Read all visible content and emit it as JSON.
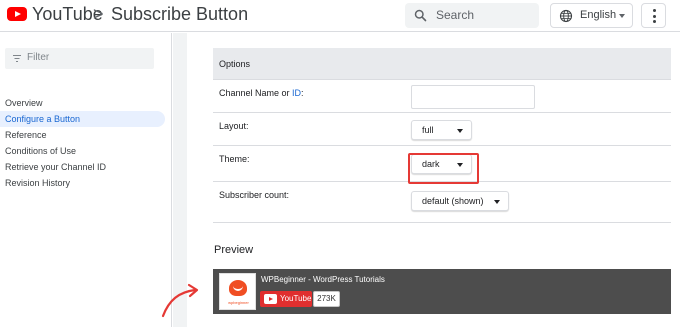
{
  "header": {
    "brand": "YouTube",
    "separator": ">",
    "crumb": "Subscribe Button",
    "search_placeholder": "Search",
    "language": "English"
  },
  "sidebar": {
    "filter_placeholder": "Filter",
    "items": [
      {
        "label": "Overview",
        "active": false
      },
      {
        "label": "Configure a Button",
        "active": true
      },
      {
        "label": "Reference",
        "active": false
      },
      {
        "label": "Conditions of Use",
        "active": false
      },
      {
        "label": "Retrieve your Channel ID",
        "active": false
      },
      {
        "label": "Revision History",
        "active": false
      }
    ]
  },
  "options": {
    "heading": "Options",
    "channel_label": "Channel Name or ",
    "channel_label_link": "ID",
    "channel_label_suffix": ":",
    "channel_value": "",
    "layout_label": "Layout:",
    "layout_value": "full",
    "theme_label": "Theme:",
    "theme_value": "dark",
    "subscriber_label": "Subscriber count:",
    "subscriber_value": "default (shown)"
  },
  "preview": {
    "title": "Preview",
    "channel_name": "WPBeginner - WordPress Tutorials",
    "avatar_text": "wpbeginner",
    "button_label": "YouTube",
    "subscriber_count": "273K"
  },
  "colors": {
    "accent": "#1967d2",
    "highlight": "#e53935",
    "youtube_red": "#ff0000",
    "preview_bg": "#4d4d4d"
  }
}
